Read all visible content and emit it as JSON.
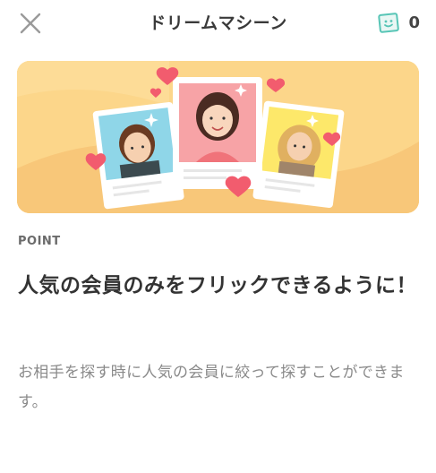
{
  "header": {
    "close_icon": "close-icon",
    "title": "ドリームマシーン",
    "ticket_icon": "ticket-icon",
    "ticket_count": "0"
  },
  "banner": {
    "image": "illustration of three member profile cards with hearts"
  },
  "content": {
    "label": "POINT",
    "heading": "人気の会員のみをフリックできるように！",
    "description": "お相手を探す時に人気の会員に絞って探すことができます。"
  },
  "colors": {
    "banner_bg": "#fcd68a",
    "heart": "#f25c6e",
    "accent_teal": "#57c5b6"
  }
}
